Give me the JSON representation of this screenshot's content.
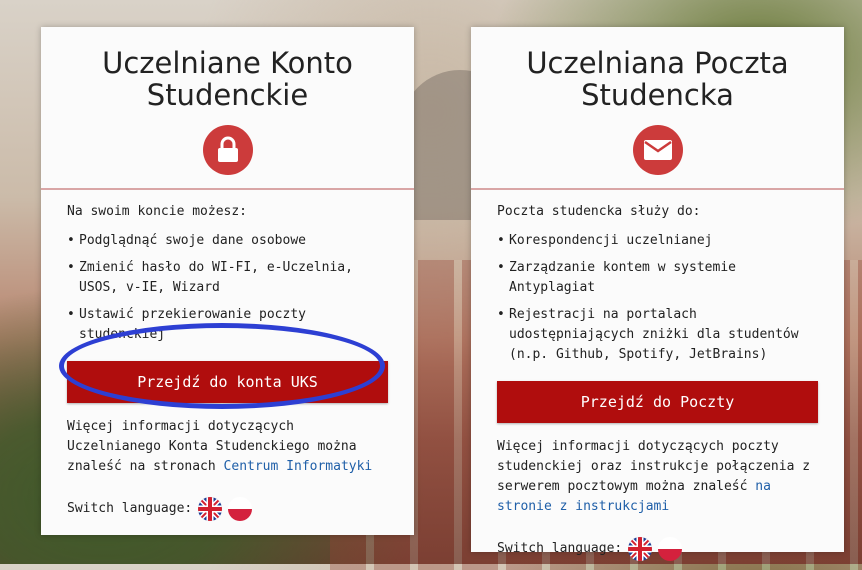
{
  "colors": {
    "accent": "#b00d0d",
    "badge": "#cc3b3b",
    "link": "#1f5fa8",
    "annotation": "#2d3fd3"
  },
  "card_uks": {
    "title": "Uczelniane Konto\nStudenckie",
    "icon": "lock-icon",
    "intro": "Na swoim koncie możesz:",
    "items": [
      "Podglądnąć swoje dane osobowe",
      "Zmienić hasło do WI-FI, e-Uczelnia, USOS, v-IE, Wizard",
      "Ustawić przekierowanie poczty studenckiej"
    ],
    "button_label": "Przejdź do konta UKS",
    "more_text": "Więcej informacji dotyczących Uczelnianego Konta Studenckiego można znaleść na stronach ",
    "more_link": "Centrum Informatyki",
    "switch_label": "Switch language:"
  },
  "card_mail": {
    "title": "Uczelniana Poczta\nStudencka",
    "icon": "envelope-icon",
    "intro": "Poczta studencka służy do:",
    "items": [
      "Korespondencji uczelnianej",
      "Zarządzanie kontem w systemie Antyplagiat",
      "Rejestracji na portalach udostępniających zniżki dla studentów (n.p. Github, Spotify, JetBrains)"
    ],
    "button_label": "Przejdź do Poczty",
    "more_text": "Więcej informacji dotyczących poczty studenckiej oraz instrukcje połączenia z serwerem pocztowym można znaleść ",
    "more_link": "na stronie z instrukcjami",
    "switch_label": "Switch language:"
  }
}
